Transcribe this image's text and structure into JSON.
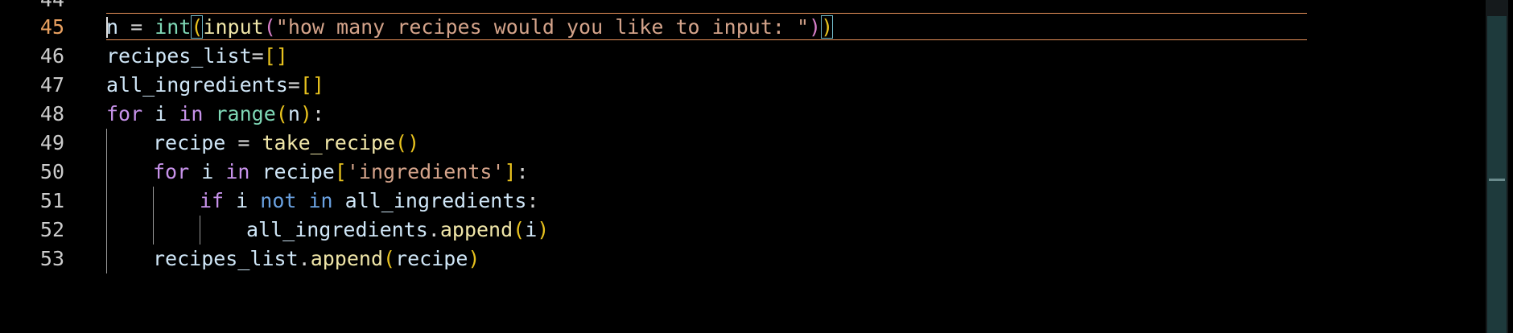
{
  "window": {
    "accent_color": "#e8915a",
    "background": "#000000"
  },
  "gutter": {
    "partial_top": "44",
    "lines": [
      "45",
      "46",
      "47",
      "48",
      "49",
      "50",
      "51",
      "52",
      "53"
    ],
    "active_line": "45"
  },
  "code": {
    "line45": {
      "n": "n",
      "eq": " = ",
      "int": "int",
      "lp1": "(",
      "input": "input",
      "lp2": "(",
      "str": "\"how many recipes would you like to input: \"",
      "rp2": ")",
      "rp1": ")"
    },
    "line46": {
      "name": "recipes_list",
      "eq": "=",
      "list": "[]"
    },
    "line47": {
      "name": "all_ingredients",
      "eq": "=",
      "list": "[]"
    },
    "line48": {
      "for": "for",
      "i": " i ",
      "in": "in",
      "sp": " ",
      "range": "range",
      "lp": "(",
      "n": "n",
      "rp": ")",
      "colon": ":"
    },
    "line49": {
      "name": "recipe",
      "eq": " = ",
      "func": "take_recipe",
      "parens": "()"
    },
    "line50": {
      "for": "for",
      "i": " i ",
      "in": "in",
      "sp": " ",
      "recipe": "recipe",
      "lb": "[",
      "key": "'ingredients'",
      "rb": "]",
      "colon": ":"
    },
    "line51": {
      "if": "if",
      "i": " i ",
      "not": "not",
      "sp": " ",
      "in": "in",
      "sp2": " ",
      "name": "all_ingredients",
      "colon": ":"
    },
    "line52": {
      "name": "all_ingredients",
      "dot": ".",
      "method": "append",
      "lp": "(",
      "arg": "i",
      "rp": ")"
    },
    "line53": {
      "name": "recipes_list",
      "dot": ".",
      "method": "append",
      "lp": "(",
      "arg": "recipe",
      "rp": ")"
    }
  },
  "scrollbar": {
    "position": 0.55
  }
}
